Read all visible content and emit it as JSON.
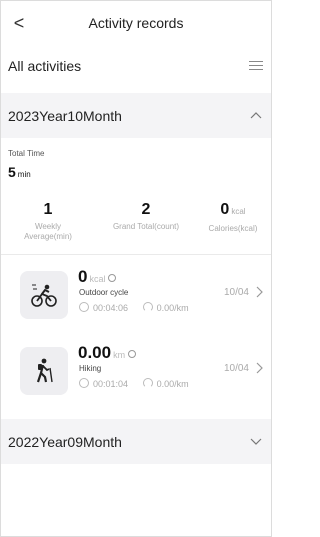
{
  "header": {
    "title": "Activity records",
    "back_glyph": "<"
  },
  "filter": {
    "label": "All activities"
  },
  "months": [
    {
      "label": "2023Year10Month",
      "expanded": true
    },
    {
      "label": "2022Year09Month",
      "expanded": false
    }
  ],
  "summary": {
    "total_label": "Total Time",
    "total_value": "5",
    "total_unit": "min",
    "stats": [
      {
        "value": "1",
        "unit": "",
        "caption_line1": "Weekly",
        "caption_line2": "Average(min)"
      },
      {
        "value": "2",
        "unit": "",
        "caption_line1": "Grand Total(count)",
        "caption_line2": ""
      },
      {
        "value": "0",
        "unit": "kcal",
        "caption_line1": "Calories(kcal)",
        "caption_line2": ""
      }
    ]
  },
  "activities": [
    {
      "value": "0",
      "unit": "kcal",
      "type": "Outdoor cycle",
      "duration": "00:04:06",
      "pace": "0.00/km",
      "date": "10/04",
      "icon": "cycling-icon"
    },
    {
      "value": "0.00",
      "unit": "km",
      "type": "Hiking",
      "duration": "00:01:04",
      "pace": "0.00/km",
      "date": "10/04",
      "icon": "hiking-icon"
    }
  ],
  "colors": {
    "month_bar_bg": "#f4f4f6",
    "icon_bg": "#eeeef1",
    "muted_text": "#aaaaaa"
  }
}
